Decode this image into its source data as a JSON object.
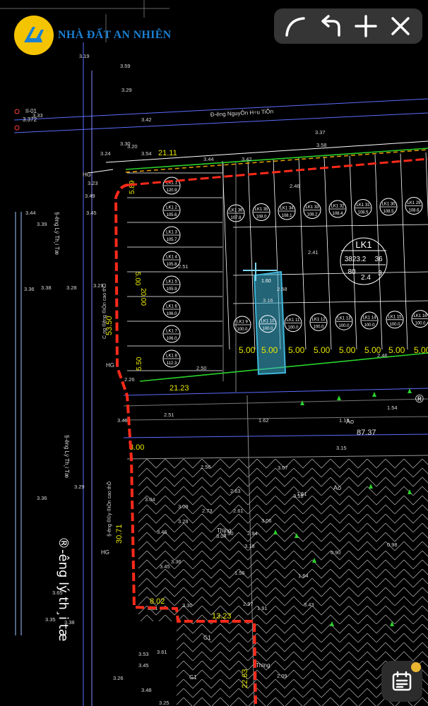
{
  "brand": {
    "name": "NHÀ ĐẤT AN NHIÊN",
    "accent": "#f5c400",
    "text_color": "#1b7fd1"
  },
  "toolbar": {
    "buttons": [
      {
        "name": "draw-curve",
        "icon": "curve-arc-icon"
      },
      {
        "name": "undo",
        "icon": "undo-arrow-icon"
      },
      {
        "name": "add",
        "icon": "plus-icon"
      },
      {
        "name": "close",
        "icon": "close-x-icon"
      }
    ]
  },
  "colors": {
    "boundary_red": "#ff2a1a",
    "boundary_dash": "#e7a000",
    "lot_outline": "#ffffff",
    "road_line": "#5b6cff",
    "highlight": "#3fb6d9",
    "dims": "#e8e800",
    "green_edge": "#2bd12b"
  },
  "streets": {
    "north": "Đ-êng NguyÔn H÷u TiÕn",
    "west_a": "§-êng Lý Th¸i Tæ",
    "west_b": "§-êng Lý Th¸i Tæ",
    "west_big": "®-êng lý th¸i tæ",
    "inner_a": "C¸ng ®êng ®iÖn cao thÕ",
    "inner_b": "§-êng ®©y ®iÖn cao thÕ"
  },
  "block_label": {
    "code": "LK1",
    "area": "3823.2",
    "lots": "36",
    "a": "80",
    "b": "2.4",
    "c": "3"
  },
  "lots_west": [
    {
      "id": "LK1 1",
      "area": "120.9"
    },
    {
      "id": "LK1 2",
      "area": "105.6"
    },
    {
      "id": "LK1 3",
      "area": "105.7"
    },
    {
      "id": "LK1 4",
      "area": "105.8"
    },
    {
      "id": "LK1 5",
      "area": "105.9"
    },
    {
      "id": "LK1 6",
      "area": "106.0"
    },
    {
      "id": "LK1 7",
      "area": "106.0"
    },
    {
      "id": "LK1 8",
      "area": "112.3"
    }
  ],
  "lots_north": [
    {
      "id": "LK1 36",
      "area": "107.8"
    },
    {
      "id": "LK1 35",
      "area": "108.0"
    },
    {
      "id": "LK1 34",
      "area": "108.1"
    },
    {
      "id": "LK1 33",
      "area": "108.2"
    },
    {
      "id": "LK1 32",
      "area": "108.4"
    },
    {
      "id": "LK1 31",
      "area": "108.5"
    },
    {
      "id": "LK1 30",
      "area": "108.5"
    },
    {
      "id": "LK1 29",
      "area": "108.6"
    }
  ],
  "lots_south": [
    {
      "id": "LK1 9",
      "area": "100.0"
    },
    {
      "id": "LK1 10",
      "area": "100.0"
    },
    {
      "id": "LK1 11",
      "area": "100.0"
    },
    {
      "id": "LK1 12",
      "area": "100.0"
    },
    {
      "id": "LK1 13",
      "area": "100.0"
    },
    {
      "id": "LK1 14",
      "area": "100.0"
    },
    {
      "id": "LK1 15",
      "area": "100.0"
    },
    {
      "id": "LK1 16",
      "area": "100.0"
    }
  ],
  "dims": {
    "d_21_11": "21.11",
    "d_21_23": "21.23",
    "d_5_00": "5.00",
    "d_3_00": "3.00",
    "d_8_02": "8.02",
    "d_13_23": "13.23",
    "d_22_63": "22.63",
    "d_30_71": "30.71",
    "d_53_50": "53.50",
    "d_87_37": "87.37",
    "d_5_50": "5.50",
    "d_5_89": "5.89",
    "d_5_00v": "5.00",
    "d_20_00": "20.00",
    "d_1_60": "1.60"
  },
  "elevations": [
    "3.19",
    "3.59",
    "3.29",
    "3.33",
    "3.42",
    "3.37",
    "3.58",
    "3.30",
    "3.20",
    "3.54",
    "3.44",
    "3.42",
    "3.24",
    "3.23",
    "3.49",
    "3.45",
    "3.44",
    "3.39",
    "3.36",
    "3.38",
    "3.28",
    "3.21",
    "3.29",
    "3.36",
    "3.35",
    "3.65",
    "3.38",
    "2.46",
    "2.41",
    "2.51",
    "2.50",
    "2.58",
    "2.46",
    "1.62",
    "1.54",
    "1.19",
    "3.15",
    "2.56",
    "2.63",
    "2.61",
    "2.73",
    "3.09",
    "3.04",
    "3.28",
    "1.51",
    "3.07",
    "3.06",
    "1.50",
    "2.94",
    "3.18",
    "1.56",
    "1.64",
    "3.43",
    "3.18",
    "0.90",
    "0.98",
    "3.46",
    "3.45",
    "3.36",
    "2.97",
    "1.91",
    "3.30",
    "3.21",
    "3.53",
    "3.61",
    "3.45",
    "3.26",
    "3.48",
    "3.25",
    "2.51",
    "3.16",
    "3.04",
    "2.09",
    "3.46",
    "2.26"
  ],
  "grid_marker": {
    "id": "II-01",
    "value": "3.372"
  },
  "misc_labels": {
    "ao": "Ao",
    "thung": "Thïng",
    "hg": "HG",
    "g1": "G1",
    "circled_r": "®"
  }
}
